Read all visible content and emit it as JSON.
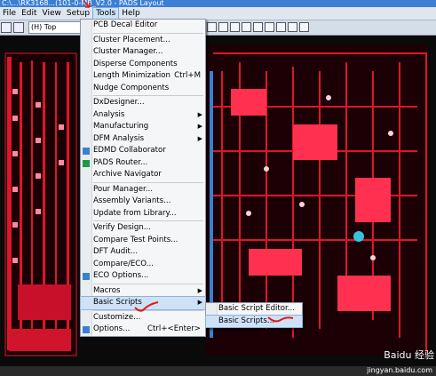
{
  "window": {
    "title": "C:\\...\\RK3168...(101-0-MB_V2.0 - PADS Layout"
  },
  "menubar": {
    "items": [
      "File",
      "Edit",
      "View",
      "Setup",
      "Tools",
      "Help"
    ],
    "active": "Tools"
  },
  "toolbar": {
    "layer": "(H) Top"
  },
  "tools_menu": {
    "items": [
      {
        "label": "PCB Decal Editor"
      },
      {
        "sep": true
      },
      {
        "label": "Cluster Placement..."
      },
      {
        "label": "Cluster Manager..."
      },
      {
        "label": "Disperse Components"
      },
      {
        "label": "Length Minimization",
        "shortcut": "Ctrl+M"
      },
      {
        "label": "Nudge Components"
      },
      {
        "sep": true
      },
      {
        "label": "DxDesigner..."
      },
      {
        "label": "Analysis",
        "submenu": true
      },
      {
        "label": "Manufacturing",
        "submenu": true
      },
      {
        "label": "DFM Analysis",
        "submenu": true
      },
      {
        "label": "EDMD Collaborator"
      },
      {
        "label": "PADS Router..."
      },
      {
        "label": "Archive Navigator"
      },
      {
        "sep": true
      },
      {
        "label": "Pour Manager..."
      },
      {
        "label": "Assembly Variants..."
      },
      {
        "label": "Update from Library..."
      },
      {
        "sep": true
      },
      {
        "label": "Verify Design..."
      },
      {
        "label": "Compare Test Points..."
      },
      {
        "label": "DFT Audit..."
      },
      {
        "label": "Compare/ECO..."
      },
      {
        "label": "ECO Options..."
      },
      {
        "sep": true
      },
      {
        "label": "Macros",
        "submenu": true
      },
      {
        "label": "Basic Scripts",
        "submenu": true,
        "highlighted": true
      },
      {
        "sep": true
      },
      {
        "label": "Customize..."
      },
      {
        "label": "Options...",
        "shortcut": "Ctrl+<Enter>"
      }
    ]
  },
  "basic_scripts_submenu": {
    "items": [
      {
        "label": "Basic Script Editor..."
      },
      {
        "label": "Basic Scripts...",
        "highlighted": true
      }
    ]
  },
  "watermark": {
    "brand": "Baidu 经验",
    "url": "jingyan.baidu.com"
  },
  "colors": {
    "menu_bg": "#f5f6f8",
    "highlight": "#cfe1f6",
    "pcb_trace_red": "#e0142a",
    "pcb_bg": "#0a0a0a",
    "annotation_red": "#e21b1b"
  }
}
